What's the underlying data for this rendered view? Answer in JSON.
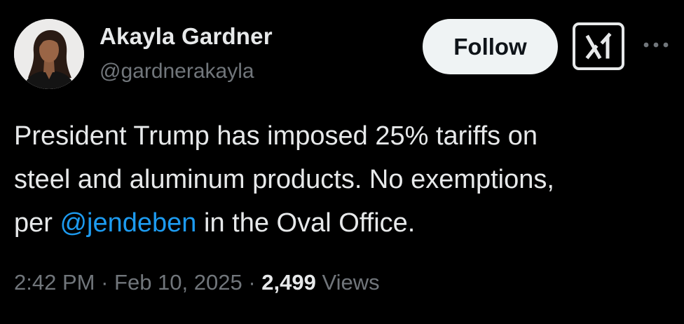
{
  "author": {
    "name": "Akayla Gardner",
    "handle": "@gardnerakayla"
  },
  "actions": {
    "follow_label": "Follow",
    "grok_icon": "grok-icon",
    "more_icon": "more-options-icon"
  },
  "tweet": {
    "line1": "President Trump has imposed 25% tariffs on",
    "line2": "steel and aluminum products. No exemptions,",
    "line3_prefix": "per ",
    "mention": "@jendeben",
    "line3_suffix": " in the Oval Office."
  },
  "meta": {
    "time": "2:42 PM",
    "sep1": " · ",
    "date": "Feb 10, 2025",
    "sep2": " · ",
    "views_count": "2,499",
    "views_label": " Views"
  },
  "colors": {
    "background": "#000000",
    "text": "#e7e9ea",
    "secondary": "#71767b",
    "link": "#1d9bf0",
    "follow_bg": "#eff3f4"
  }
}
